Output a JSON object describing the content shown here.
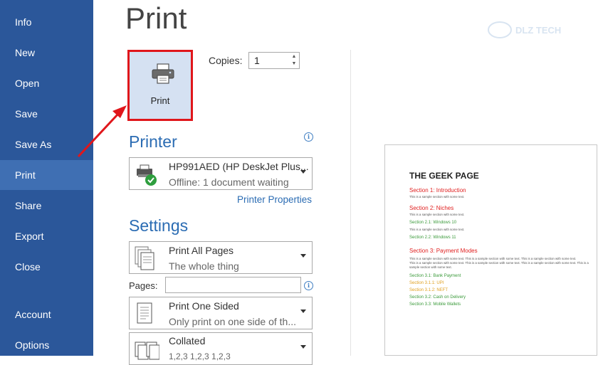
{
  "sidebar": {
    "items": [
      {
        "label": "Info"
      },
      {
        "label": "New"
      },
      {
        "label": "Open"
      },
      {
        "label": "Save"
      },
      {
        "label": "Save As"
      },
      {
        "label": "Print",
        "active": true
      },
      {
        "label": "Share"
      },
      {
        "label": "Export"
      },
      {
        "label": "Close"
      },
      {
        "label": "Account"
      },
      {
        "label": "Options"
      }
    ]
  },
  "page_title": "Print",
  "print_button": {
    "label": "Print",
    "icon": "printer-icon"
  },
  "copies": {
    "label": "Copies:",
    "value": "1"
  },
  "printer": {
    "header": "Printer",
    "name": "HP991AED (HP DeskJet Plus...",
    "status": "Offline: 1 document waiting",
    "properties_link": "Printer Properties"
  },
  "settings": {
    "header": "Settings",
    "pages_label": "Pages:",
    "print_range": {
      "title": "Print All Pages",
      "subtitle": "The whole thing"
    },
    "sides": {
      "title": "Print One Sided",
      "subtitle": "Only print on one side of th..."
    },
    "collation": {
      "title": "Collated",
      "subtitle": "1,2,3 1,2,3 1,2,3"
    }
  },
  "preview": {
    "title": "THE GEEK PAGE",
    "sections": [
      {
        "text": "Section 1: Introduction",
        "kind": "h1"
      },
      {
        "text": "This is a sample section with some text.",
        "kind": "body"
      },
      {
        "text": "Section 2: Niches",
        "kind": "h1"
      },
      {
        "text": "This is a sample section with some text.",
        "kind": "body"
      },
      {
        "text": "Section 2.1: Windows 10",
        "kind": "h2"
      },
      {
        "text": "This is a sample section with some text.",
        "kind": "body"
      },
      {
        "text": "Section 2.2: Windows 11",
        "kind": "h2"
      },
      {
        "text": "Section 3: Payment Modes",
        "kind": "h1"
      },
      {
        "text": "This is a sample section with some text. This is a sample section with some text. This is a sample section with some text.",
        "kind": "body"
      },
      {
        "text": "This is a sample section with some text. This is a sample section with some text. This is a sample section with some text. This is a",
        "kind": "body"
      },
      {
        "text": "sample section with some text.",
        "kind": "body"
      },
      {
        "text": "Section 3.1: Bank Payment",
        "kind": "h2"
      },
      {
        "text": "Section 3.1.1: UPI",
        "kind": "h3"
      },
      {
        "text": "Section 3.1.2: NEFT",
        "kind": "h3"
      },
      {
        "text": "Section 3.2: Cash on Delivery",
        "kind": "h2"
      },
      {
        "text": "Section 3.3: Mobile Wallets",
        "kind": "h2"
      }
    ]
  },
  "watermark": {
    "text": "DLZ TECH"
  },
  "colors": {
    "sidebar": "#2b579a",
    "sidebar_active": "#3f6fb3",
    "accent_blue": "#2b6cb3",
    "highlight_red": "#e0161b",
    "print_button_bg": "#d5e1f2"
  }
}
